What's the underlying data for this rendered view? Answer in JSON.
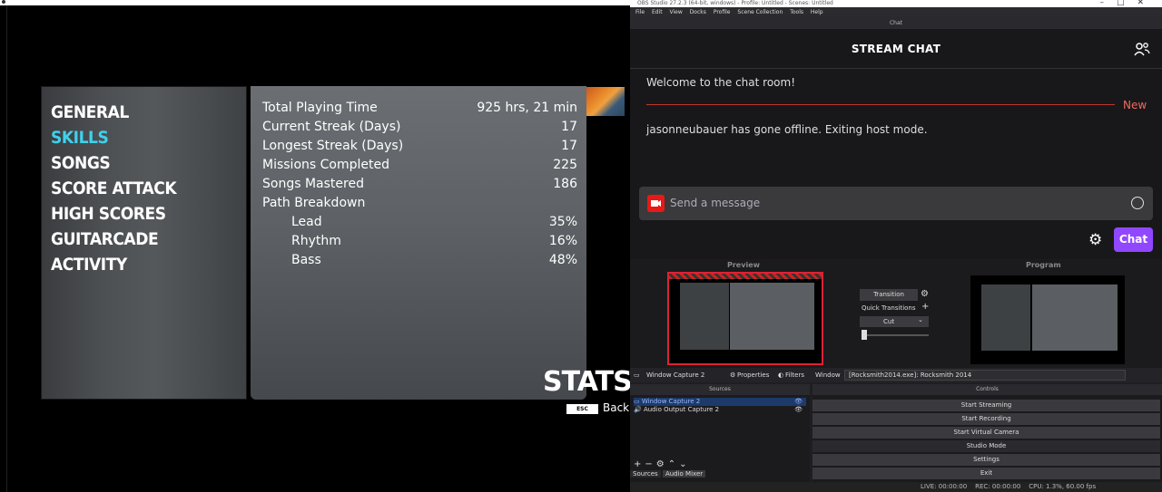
{
  "game": {
    "menu": [
      "GENERAL",
      "SKILLS",
      "SONGS",
      "SCORE ATTACK",
      "HIGH SCORES",
      "GUITARCADE",
      "ACTIVITY"
    ],
    "active_index": 1,
    "stats": [
      {
        "label": "Total Playing Time",
        "value": "925 hrs, 21 min",
        "indent": false
      },
      {
        "label": "Current Streak (Days)",
        "value": "17",
        "indent": false
      },
      {
        "label": "Longest Streak (Days)",
        "value": "17",
        "indent": false
      },
      {
        "label": "Missions Completed",
        "value": "225",
        "indent": false
      },
      {
        "label": "Songs Mastered",
        "value": "186",
        "indent": false
      },
      {
        "label": "Path Breakdown",
        "value": "",
        "indent": false
      },
      {
        "label": "Lead",
        "value": "35%",
        "indent": true
      },
      {
        "label": "Rhythm",
        "value": "16%",
        "indent": true
      },
      {
        "label": "Bass",
        "value": "48%",
        "indent": true
      }
    ],
    "title": "STATS",
    "esc_key": "ESC",
    "back_label": "Back"
  },
  "obs": {
    "title": "OBS Studio 27.2.3 (64-bit, windows) - Profile: Untitled - Scenes: Untitled",
    "menus": [
      "File",
      "Edit",
      "View",
      "Docks",
      "Profile",
      "Scene Collection",
      "Tools",
      "Help"
    ],
    "chat_dock_title": "Chat",
    "chat": {
      "header": "STREAM CHAT",
      "welcome": "Welcome to the chat room!",
      "new_label": "New",
      "offline_msg": "jasonneubauer has gone offline. Exiting host mode.",
      "placeholder": "Send a message",
      "send_label": "Chat",
      "accent": "#9147ff"
    },
    "preview_label": "Preview",
    "program_label": "Program",
    "transition_label": "Transition",
    "quick_transitions_label": "Quick Transitions",
    "cut_label": "Cut",
    "source_toolbar": {
      "source_name": "Window Capture 2",
      "properties": "Properties",
      "filters": "Filters",
      "window_label": "Window",
      "window_value": "[Rocksmith2014.exe]: Rocksmith 2014"
    },
    "sources_title": "Sources",
    "sources": [
      "Window Capture 2",
      "Audio Output Capture 2"
    ],
    "dock_tabs": [
      "Sources",
      "Audio Mixer"
    ],
    "controls_title": "Controls",
    "controls": [
      "Start Streaming",
      "Start Recording",
      "Start Virtual Camera",
      "Studio Mode",
      "Settings",
      "Exit"
    ],
    "status": {
      "live": "LIVE: 00:00:00",
      "rec": "REC: 00:00:00",
      "cpu": "CPU: 1.3%, 60.00 fps"
    }
  }
}
